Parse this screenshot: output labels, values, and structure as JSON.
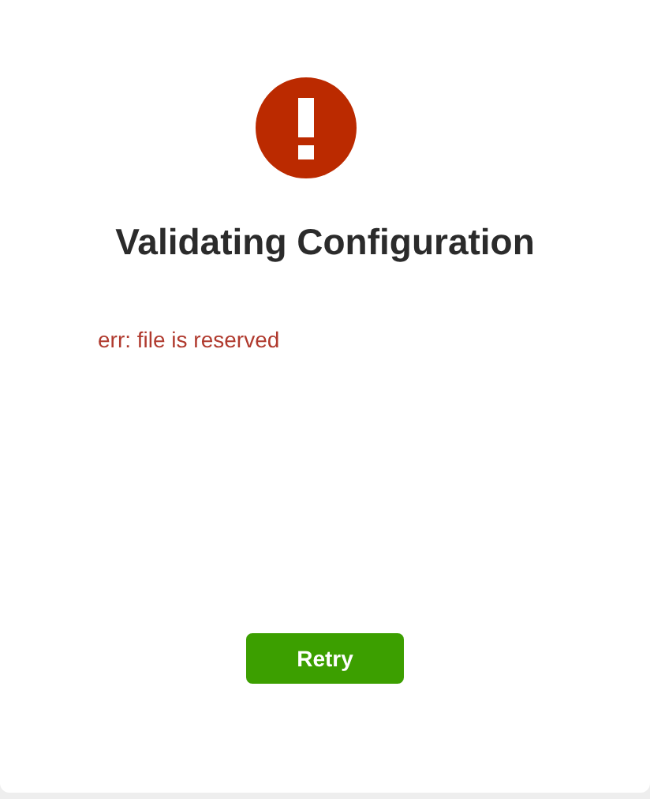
{
  "title": "Validating Configuration",
  "error": "err: file is reserved",
  "buttons": [
    {
      "label": "Retry"
    }
  ]
}
